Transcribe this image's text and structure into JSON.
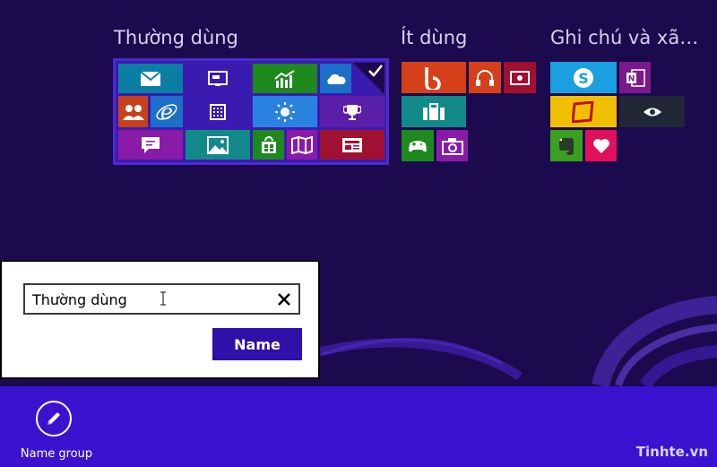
{
  "groups": [
    {
      "title": "Thường dùng"
    },
    {
      "title": "Ít dùng"
    },
    {
      "title": "Ghi chú và xã…"
    }
  ],
  "dialog": {
    "input_value": "Thường dùng",
    "name_button": "Name"
  },
  "app_bar": {
    "name_group_label": "Name group"
  },
  "watermark": "Tinhte.vn",
  "tiles": [
    {
      "icon": "mail-icon",
      "color": "#0b7fa3"
    },
    {
      "icon": "desktop-icon",
      "color": "#3a1bb0"
    },
    {
      "icon": "finance-icon",
      "color": "#1e8a1e"
    },
    {
      "icon": "onedrive-icon",
      "color": "#1b6fc7"
    },
    {
      "icon": "people-icon",
      "color": "#c8401a"
    },
    {
      "icon": "internet-explorer-icon",
      "color": "#1b6fc7"
    },
    {
      "icon": "calculator-icon",
      "color": "#3a1bb0"
    },
    {
      "icon": "weather-icon",
      "color": "#2a82e0"
    },
    {
      "icon": "trophy-icon",
      "color": "#5b1ea8"
    },
    {
      "icon": "messaging-icon",
      "color": "#8a1aa8"
    },
    {
      "icon": "photos-icon",
      "color": "#138a8a"
    },
    {
      "icon": "store-icon",
      "color": "#1e8a1e"
    },
    {
      "icon": "maps-icon",
      "color": "#8a1aa8"
    },
    {
      "icon": "news-icon",
      "color": "#a01030"
    },
    {
      "icon": "bing-icon",
      "color": "#d5401a"
    },
    {
      "icon": "music-icon",
      "color": "#d5401a"
    },
    {
      "icon": "video-icon",
      "color": "#a01030"
    },
    {
      "icon": "travel-icon",
      "color": "#138a8a"
    },
    {
      "icon": "games-icon",
      "color": "#1e8a1e"
    },
    {
      "icon": "camera-icon",
      "color": "#8a1aa8"
    },
    {
      "icon": "skype-icon",
      "color": "#1aa0e0"
    },
    {
      "icon": "onenote-icon",
      "color": "#7a1a8a"
    },
    {
      "icon": "reading-list-icon",
      "color": "#f0c000"
    },
    {
      "icon": "eye-icon",
      "color": "#202838"
    },
    {
      "icon": "evernote-icon",
      "color": "#3aa020"
    },
    {
      "icon": "health-icon",
      "color": "#e0105a"
    }
  ],
  "colors": {
    "background": "#1b0a4d",
    "app_bar": "#3a12d0",
    "accent": "#2d11a8"
  }
}
